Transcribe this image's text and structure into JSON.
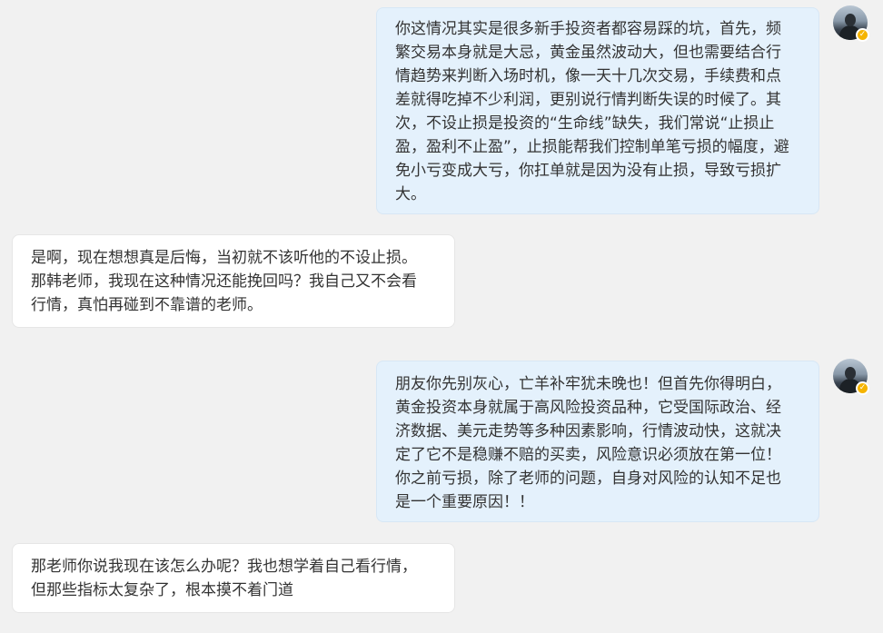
{
  "messages": [
    {
      "sender": "self",
      "lines": [
        "你这情况其实是很多新手投资者都容易踩的坑，首先，频",
        "繁交易本身就是大忌，黄金虽然波动大，但也需要结合行",
        "情趋势来判断入场时机，像一天十几次交易，手续费和点",
        "差就得吃掉不少利润，更别说行情判断失误的时候了。其",
        "次，不设止损是投资的“生命线”缺失，我们常说“止损止",
        "盈，盈利不止盈”，止损能帮我们控制单笔亏损的幅度，避",
        "免小亏变成大亏，你扛单就是因为没有止损，导致亏损扩",
        "大。"
      ]
    },
    {
      "sender": "other",
      "lines": [
        "是啊，现在想想真是后悔，当初就不该听他的不设止损。",
        "那韩老师，我现在这种情况还能挽回吗？我自己又不会看",
        "行情，真怕再碰到不靠谱的老师。"
      ]
    },
    {
      "sender": "self",
      "lines": [
        "朋友你先别灰心，亡羊补牢犹未晚也！但首先你得明白，",
        "黄金投资本身就属于高风险投资品种，它受国际政治、经",
        "济数据、美元走势等多种因素影响，行情波动快，这就决",
        "定了它不是稳赚不赔的买卖，风险意识必须放在第一位！",
        "你之前亏损，除了老师的问题，自身对风险的认知不足也",
        "是一个重要原因！！"
      ]
    },
    {
      "sender": "other",
      "lines": [
        "那老师你说我现在该怎么办呢？我也想学着自己看行情，",
        "但那些指标太复杂了，根本摸不着门道"
      ]
    }
  ],
  "colors": {
    "background": "#f1f1f1",
    "self_bubble": "#e4f1fc",
    "other_bubble": "#ffffff",
    "verified_badge": "#f5b400"
  },
  "icons": {
    "avatar": "user-avatar",
    "badge": "verified-badge-icon"
  }
}
